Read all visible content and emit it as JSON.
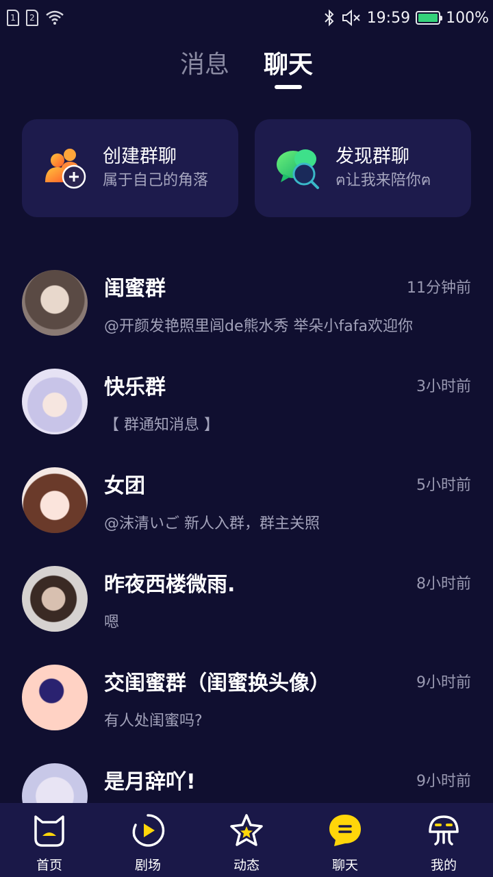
{
  "status_bar": {
    "sim1": "1",
    "sim2": "2",
    "time": "19:59",
    "battery": "100%"
  },
  "tabs": [
    {
      "label": "消息"
    },
    {
      "label": "聊天"
    }
  ],
  "cards": [
    {
      "title": "创建群聊",
      "subtitle": "属于自己的角落"
    },
    {
      "title": "发现群聊",
      "subtitle": "ฅ让我来陪你ฅ"
    }
  ],
  "chats": [
    {
      "name": "闺蜜群",
      "time": "11分钟前",
      "message": "@开颜发艳照里闾de熊水秀 举朵小fafa欢迎你"
    },
    {
      "name": "快乐群",
      "time": "3小时前",
      "message": "【 群通知消息 】"
    },
    {
      "name": "女团",
      "time": "5小时前",
      "message": "@沫清いご 新人入群，群主关照"
    },
    {
      "name": "昨夜西楼微雨.",
      "time": "8小时前",
      "message": "嗯"
    },
    {
      "name": "交闺蜜群（闺蜜换头像）",
      "time": "9小时前",
      "message": "有人处闺蜜吗?"
    },
    {
      "name": "是月辞吖!",
      "time": "9小时前",
      "message": ""
    }
  ],
  "bottom_nav": [
    {
      "label": "首页",
      "icon": "home-cat-icon"
    },
    {
      "label": "剧场",
      "icon": "theater-play-icon"
    },
    {
      "label": "动态",
      "icon": "star-icon"
    },
    {
      "label": "聊天",
      "icon": "chat-bubble-icon"
    },
    {
      "label": "我的",
      "icon": "profile-jelly-icon"
    }
  ],
  "colors": {
    "background": "#100f30",
    "card": "#1d1b4c",
    "nav": "#1a1848",
    "accent": "#ffd60a"
  }
}
